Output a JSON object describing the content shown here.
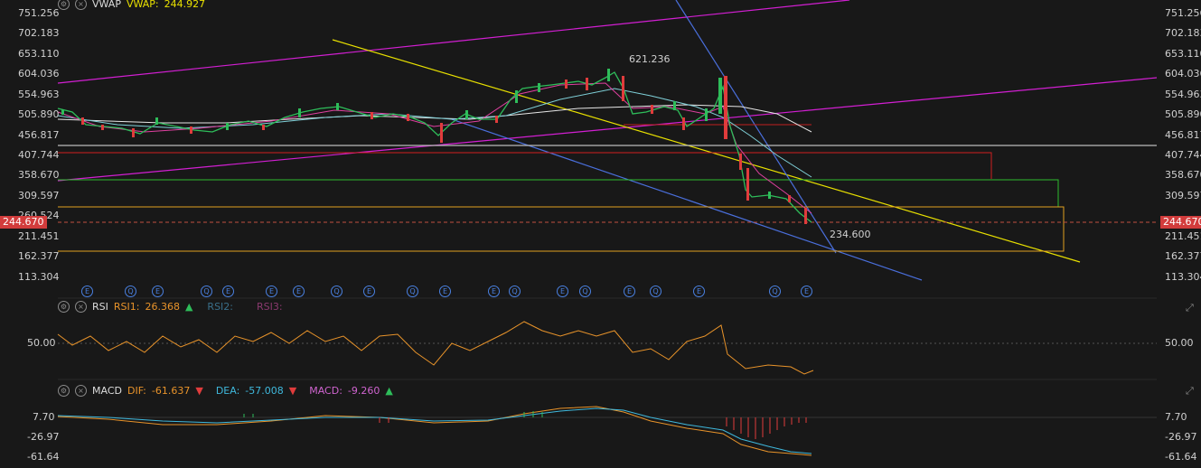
{
  "main": {
    "indicator": "VWAP",
    "vwap_label": "VWAP:",
    "vwap_value": "244.927",
    "price_axis": [
      "751.256",
      "702.183",
      "653.110",
      "604.036",
      "554.963",
      "505.890",
      "456.817",
      "407.744",
      "358.670",
      "309.597",
      "260.524",
      "211.451",
      "162.377",
      "113.304"
    ],
    "current_price": "244.670",
    "high_label": "621.236",
    "low_label": "234.600",
    "event_markers": [
      "E",
      "Q",
      "E",
      "Q",
      "E",
      "E",
      "E",
      "Q",
      "E",
      "Q",
      "E",
      "E",
      "Q",
      "E",
      "Q",
      "E",
      "Q",
      "E",
      "Q",
      "E"
    ],
    "colors": {
      "channel": "#d21fd2",
      "trend": "#e8e000",
      "blue": "#4a6fdc",
      "red_box": "#d02020",
      "green_box": "#2ebd2e",
      "orange_box": "#e0a020",
      "up": "#2ebd5a",
      "down": "#e03c3c"
    }
  },
  "rsi": {
    "name": "RSI",
    "rsi1_label": "RSI1:",
    "rsi1_value": "26.368",
    "rsi2_label": "RSI2:",
    "rsi3_label": "RSI3:",
    "level": "50.00"
  },
  "macd": {
    "name": "MACD",
    "dif_label": "DIF:",
    "dif_value": "-61.637",
    "dea_label": "DEA:",
    "dea_value": "-57.008",
    "macd_label": "MACD:",
    "macd_value": "-9.260",
    "axis": [
      "7.70",
      "-26.97",
      "-61.64"
    ]
  }
}
